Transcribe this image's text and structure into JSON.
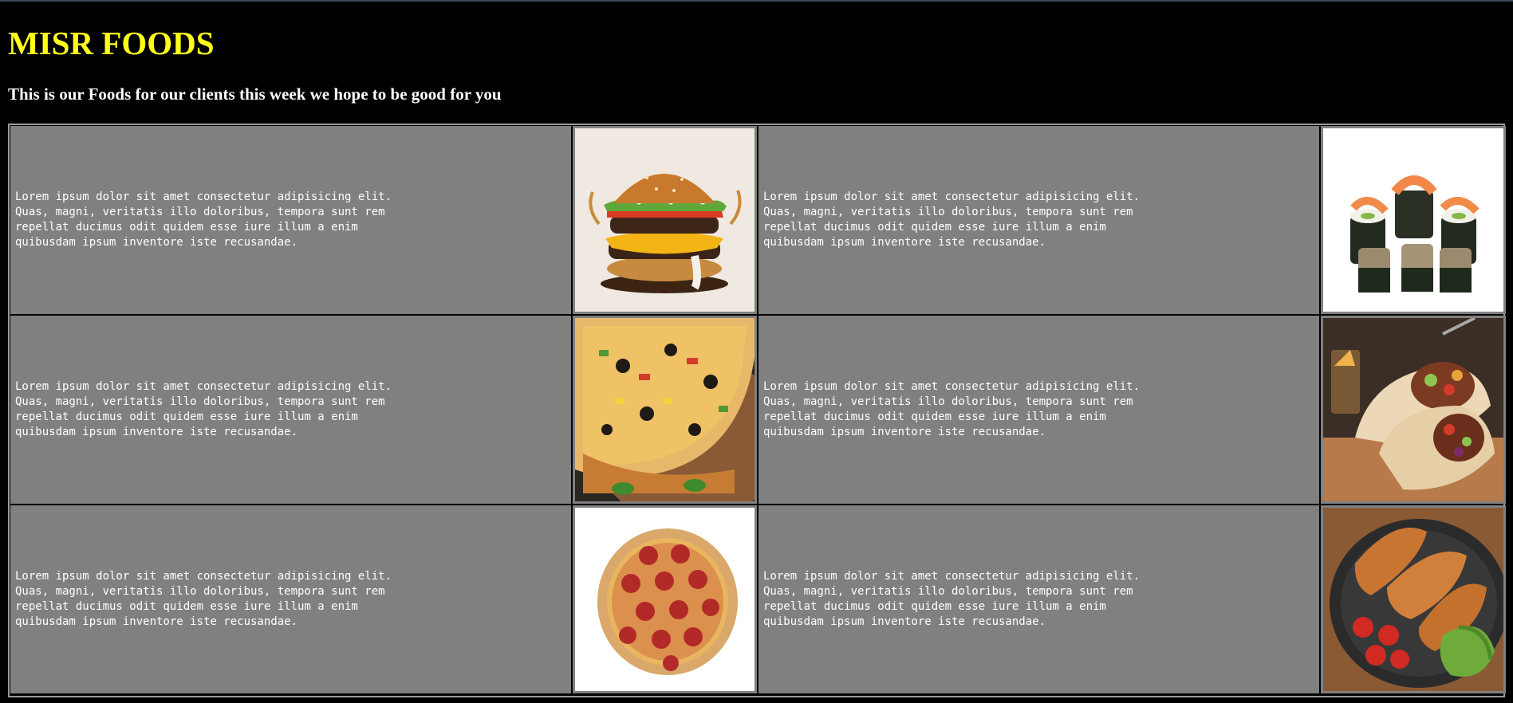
{
  "page": {
    "title": "MISR FOODS",
    "subtitle": "This is our Foods for our clients this week we hope to be good for you"
  },
  "foods": [
    {
      "description": "Lorem ipsum dolor sit amet consectetur adipisicing elit. Quas, magni, veritatis illo doloribus, tempora sunt rem repellat ducimus odit quidem esse iure illum a enim quibusdam ipsum inventore iste recusandae.",
      "image": "burger"
    },
    {
      "description": "Lorem ipsum dolor sit amet consectetur adipisicing elit. Quas, magni, veritatis illo doloribus, tempora sunt rem repellat ducimus odit quidem esse iure illum a enim quibusdam ipsum inventore iste recusandae.",
      "image": "sushi"
    },
    {
      "description": "Lorem ipsum dolor sit amet consectetur adipisicing elit. Quas, magni, veritatis illo doloribus, tempora sunt rem repellat ducimus odit quidem esse iure illum a enim quibusdam ipsum inventore iste recusandae.",
      "image": "pizza-slice"
    },
    {
      "description": "Lorem ipsum dolor sit amet consectetur adipisicing elit. Quas, magni, veritatis illo doloribus, tempora sunt rem repellat ducimus odit quidem esse iure illum a enim quibusdam ipsum inventore iste recusandae.",
      "image": "wrap"
    },
    {
      "description": "Lorem ipsum dolor sit amet consectetur adipisicing elit. Quas, magni, veritatis illo doloribus, tempora sunt rem repellat ducimus odit quidem esse iure illum a enim quibusdam ipsum inventore iste recusandae.",
      "image": "pepperoni-pizza"
    },
    {
      "description": "Lorem ipsum dolor sit amet consectetur adipisicing elit. Quas, magni, veritatis illo doloribus, tempora sunt rem repellat ducimus odit quidem esse iure illum a enim quibusdam ipsum inventore iste recusandae.",
      "image": "fried-chicken"
    }
  ],
  "colors": {
    "background": "#000000",
    "title": "#ffff1a",
    "cell": "#808080",
    "text": "#ffffff"
  }
}
